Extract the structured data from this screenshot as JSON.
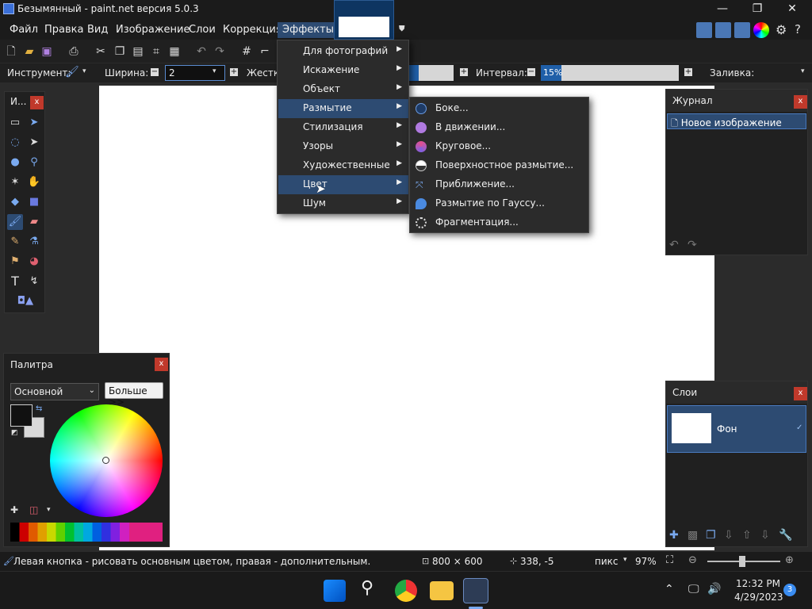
{
  "window": {
    "title": "Безымянный - paint.net версия 5.0.3",
    "controls": {
      "minimize": "—",
      "maximize": "❐",
      "close": "✕"
    }
  },
  "menubar": {
    "items": [
      "Файл",
      "Правка",
      "Вид",
      "Изображение",
      "Слои",
      "Коррекция",
      "Эффекты"
    ],
    "active": "Эффекты"
  },
  "toolbar": {
    "instrument_label": "Инструмент:",
    "width_label": "Ширина:",
    "width_value": "2",
    "hardness_label": "Жестко",
    "interval_label": "Интервал:",
    "interval_value": "15%",
    "fill_label": "Заливка:"
  },
  "effects_menu": {
    "items": [
      {
        "label": "Для фотографий"
      },
      {
        "label": "Искажение"
      },
      {
        "label": "Объект"
      },
      {
        "label": "Размытие"
      },
      {
        "label": "Стилизация"
      },
      {
        "label": "Узоры"
      },
      {
        "label": "Художественные"
      },
      {
        "label": "Цвет"
      },
      {
        "label": "Шум"
      }
    ],
    "highlighted": "Размытие"
  },
  "blur_submenu": {
    "items": [
      {
        "label": "Боке...",
        "icon": "bokeh-icon"
      },
      {
        "label": "В движении...",
        "icon": "motion-blur-icon"
      },
      {
        "label": "Круговое...",
        "icon": "radial-blur-icon"
      },
      {
        "label": "Поверхностное размытие...",
        "icon": "surface-blur-icon"
      },
      {
        "label": "Приближение...",
        "icon": "zoom-blur-icon"
      },
      {
        "label": "Размытие по Гауссу...",
        "icon": "gaussian-blur-icon"
      },
      {
        "label": "Фрагментация...",
        "icon": "fragment-icon"
      }
    ]
  },
  "tools_panel": {
    "title": "И..."
  },
  "history_panel": {
    "title": "Журнал",
    "items": [
      "Новое изображение"
    ]
  },
  "layers_panel": {
    "title": "Слои",
    "layers": [
      {
        "name": "Фон",
        "visible": true
      }
    ]
  },
  "palette_panel": {
    "title": "Палитра",
    "mode": "Основной",
    "more_button": "Больше >>",
    "primary_color": "#111111",
    "secondary_color": "#d9d9d9"
  },
  "status": {
    "hint": "Левая кнопка - рисовать основным цветом, правая - дополнительным.",
    "size": "800 × 600",
    "coords": "338, -5",
    "units": "пикс",
    "zoom": "97%"
  },
  "taskbar": {
    "time": "12:32 PM",
    "date": "4/29/2023",
    "notifications": "3"
  },
  "colors": {
    "accent": "#2d4b72",
    "selection": "#1f5fa8"
  }
}
